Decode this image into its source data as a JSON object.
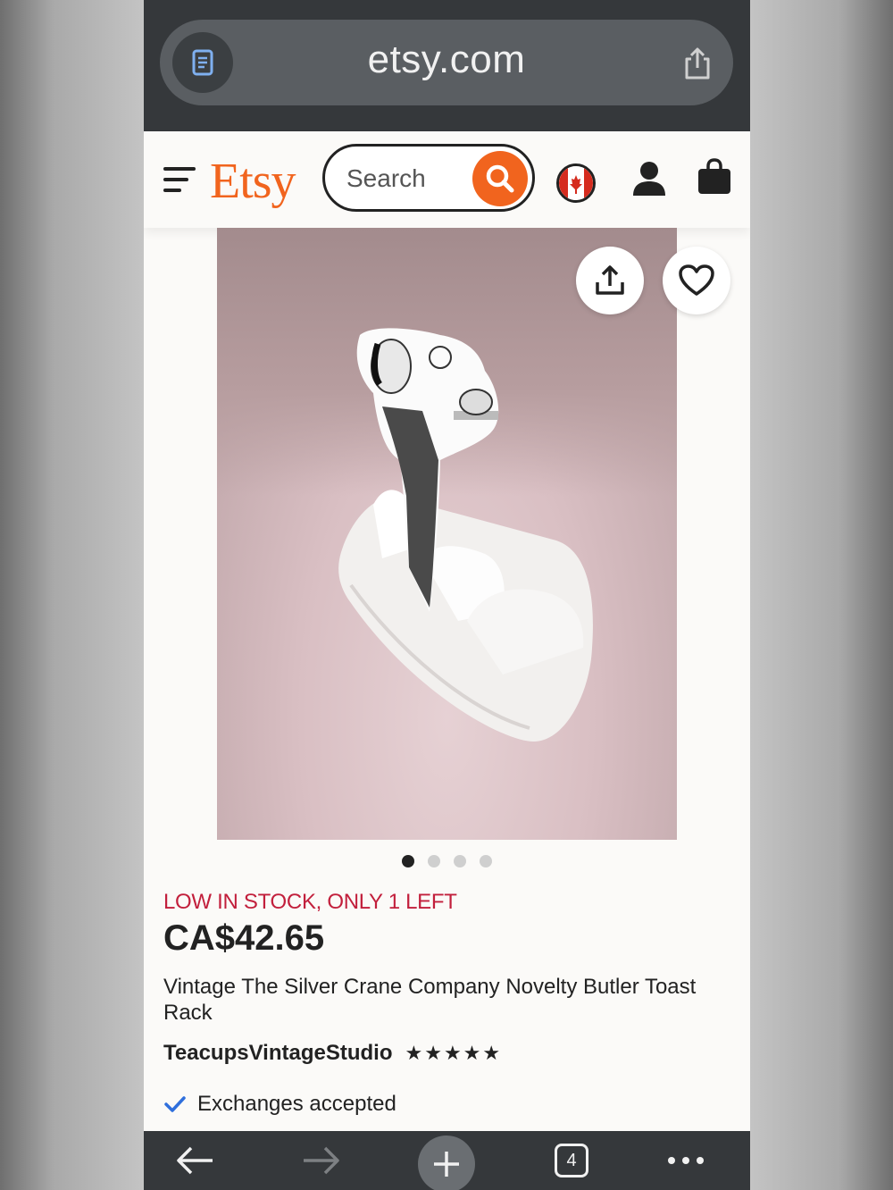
{
  "browser": {
    "url": "etsy.com",
    "open_tabs": "4"
  },
  "header": {
    "logo": "Etsy",
    "search_placeholder": "Search",
    "region": "Canada"
  },
  "product": {
    "stock_message": "LOW IN STOCK, ONLY 1 LEFT",
    "price": "CA$42.65",
    "title": "Vintage The Silver Crane Company Novelty Butler Toast Rack",
    "shop_name": "TeacupsVintageStudio",
    "rating_stars": "★★★★★",
    "rating": 5,
    "exchanges": "Exchanges accepted",
    "image_count": 4,
    "current_image": 1
  },
  "colors": {
    "brand": "#f1641e",
    "stock_alert": "#c21f3c",
    "check": "#2f6fdc",
    "browser_chrome": "#35383b"
  }
}
